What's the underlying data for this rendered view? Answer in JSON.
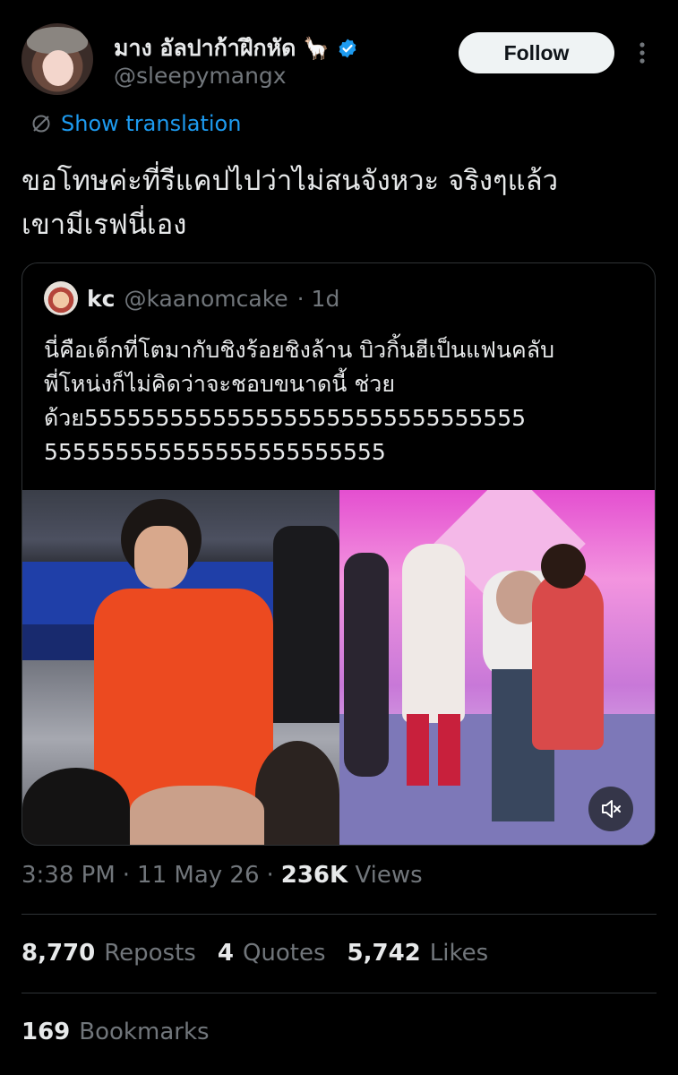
{
  "author": {
    "display_name": "มาง อัลปาก้าฝึกหัด",
    "emoji": "🦙",
    "handle": "@sleepymangx"
  },
  "follow_label": "Follow",
  "translate_label": "Show translation",
  "tweet_text": "ขอโทษค่ะที่รีแคปไปว่าไม่สนจังหวะ จริงๆแล้ว\nเขามีเรฟนี่เอง",
  "quote": {
    "name": "kc",
    "handle": "@kaanomcake",
    "time": "· 1d",
    "text": "นี่คือเด็กที่โตมากับชิงร้อยชิงล้าน บิวกิ้นฮีเป็นแฟนคลับ\nพี่โหน่งก็ไม่คิดว่าจะชอบขนาดนี้ ช่วย\nด้วย5555555555555555555555555555555\n555555555555555555555555"
  },
  "meta": {
    "time": "3:38 PM",
    "sep1": "·",
    "date": "11 May 26",
    "sep2": "·",
    "views_count": "236K",
    "views_label": "Views"
  },
  "stats": {
    "reposts_count": "8,770",
    "reposts_label": "Reposts",
    "quotes_count": "4",
    "quotes_label": "Quotes",
    "likes_count": "5,742",
    "likes_label": "Likes",
    "bookmarks_count": "169",
    "bookmarks_label": "Bookmarks"
  },
  "colors": {
    "background": "#000000",
    "accent": "#1d9bf0",
    "secondary_text": "#71767b",
    "divider": "#2f3336"
  }
}
